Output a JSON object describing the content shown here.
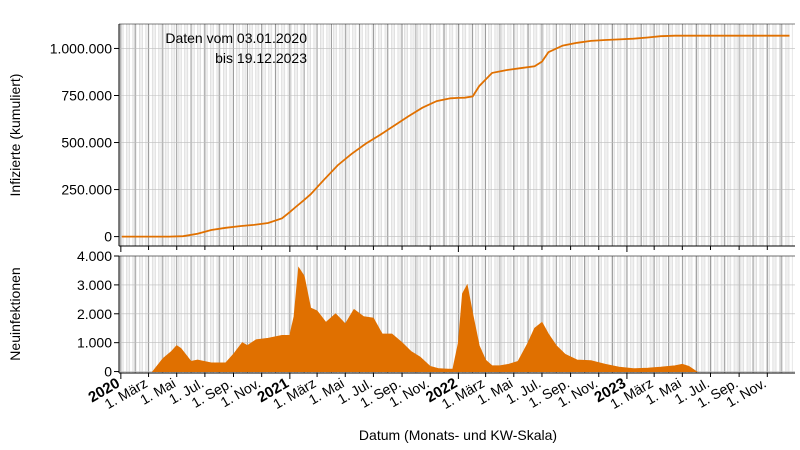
{
  "chart_data": [
    {
      "type": "line",
      "ylabel": "Infizierte (kumuliert)",
      "annotation": [
        "Daten vom 03.01.2020",
        "bis 19.12.2023"
      ],
      "ylim": [
        -50000,
        1130000
      ],
      "yticks": [
        0,
        250000,
        500000,
        750000,
        1000000
      ],
      "ytick_labels": [
        "0",
        "250.000",
        "500.000",
        "750.000",
        "1.000.000"
      ],
      "grid": true,
      "color": "#e07000",
      "x": [
        "2020-01-03",
        "2020-02-15",
        "2020-03-15",
        "2020-04-15",
        "2020-05-15",
        "2020-06-15",
        "2020-07-15",
        "2020-08-15",
        "2020-09-15",
        "2020-10-15",
        "2020-11-15",
        "2020-12-15",
        "2021-01-01",
        "2021-01-15",
        "2021-02-01",
        "2021-02-15",
        "2021-03-15",
        "2021-04-15",
        "2021-05-15",
        "2021-06-15",
        "2021-07-15",
        "2021-08-15",
        "2021-09-15",
        "2021-10-15",
        "2021-11-15",
        "2021-12-15",
        "2022-01-01",
        "2022-01-15",
        "2022-02-01",
        "2022-02-15",
        "2022-03-15",
        "2022-04-15",
        "2022-05-15",
        "2022-06-15",
        "2022-07-01",
        "2022-07-15",
        "2022-08-15",
        "2022-09-15",
        "2022-10-15",
        "2022-11-15",
        "2022-12-15",
        "2023-01-15",
        "2023-02-15",
        "2023-03-15",
        "2023-04-15",
        "2023-05-15",
        "2023-06-15",
        "2023-09-15",
        "2023-12-19"
      ],
      "values": [
        0,
        0,
        0,
        0,
        2000,
        15000,
        35000,
        47000,
        56000,
        62000,
        72000,
        97000,
        130000,
        160000,
        195000,
        225000,
        300000,
        380000,
        440000,
        495000,
        540000,
        590000,
        640000,
        685000,
        720000,
        735000,
        737000,
        738000,
        745000,
        800000,
        870000,
        885000,
        895000,
        905000,
        930000,
        980000,
        1015000,
        1030000,
        1040000,
        1045000,
        1048000,
        1052000,
        1058000,
        1065000,
        1068000,
        1068000,
        1068000,
        1068000,
        1068000
      ]
    },
    {
      "type": "area",
      "ylabel": "Neuinfektionen",
      "ylim": [
        -50,
        4000
      ],
      "yticks": [
        0,
        1000,
        2000,
        3000,
        4000
      ],
      "ytick_labels": [
        "0",
        "1.000",
        "2.000",
        "3.000",
        "4.000"
      ],
      "grid": true,
      "color": "#e07000",
      "x": [
        "2020-03-10",
        "2020-04-01",
        "2020-04-20",
        "2020-05-01",
        "2020-05-10",
        "2020-06-01",
        "2020-06-15",
        "2020-07-15",
        "2020-08-15",
        "2020-09-01",
        "2020-09-20",
        "2020-10-01",
        "2020-10-20",
        "2020-11-15",
        "2020-12-15",
        "2021-01-01",
        "2021-01-10",
        "2021-01-20",
        "2021-02-01",
        "2021-02-15",
        "2021-03-01",
        "2021-03-20",
        "2021-04-10",
        "2021-05-01",
        "2021-05-20",
        "2021-06-10",
        "2021-07-01",
        "2021-07-20",
        "2021-08-10",
        "2021-09-01",
        "2021-09-20",
        "2021-10-10",
        "2021-11-01",
        "2021-11-20",
        "2021-12-10",
        "2021-12-20",
        "2022-01-01",
        "2022-01-10",
        "2022-01-20",
        "2022-02-01",
        "2022-02-15",
        "2022-03-01",
        "2022-03-15",
        "2022-04-01",
        "2022-04-20",
        "2022-05-10",
        "2022-06-01",
        "2022-06-15",
        "2022-07-01",
        "2022-07-15",
        "2022-08-01",
        "2022-08-20",
        "2022-09-15",
        "2022-10-15",
        "2022-11-15",
        "2022-12-15",
        "2023-01-15",
        "2023-02-15",
        "2023-03-15",
        "2023-04-15",
        "2023-05-01",
        "2023-05-15",
        "2023-06-01"
      ],
      "values": [
        0,
        450,
        700,
        900,
        800,
        350,
        400,
        300,
        300,
        600,
        1000,
        900,
        1100,
        1150,
        1250,
        1250,
        1900,
        3600,
        3300,
        2200,
        2100,
        1700,
        2000,
        1650,
        2150,
        1900,
        1850,
        1300,
        1300,
        1000,
        700,
        500,
        180,
        100,
        80,
        80,
        1000,
        2700,
        3000,
        2000,
        900,
        400,
        200,
        200,
        250,
        350,
        1000,
        1500,
        1700,
        1300,
        900,
        600,
        400,
        380,
        250,
        150,
        100,
        120,
        150,
        200,
        250,
        180,
        0
      ]
    }
  ],
  "xaxis": {
    "label": "Datum (Monats- und KW-Skala)",
    "ticks": [
      {
        "date": "2020-01-01",
        "text": "2020",
        "year": true
      },
      {
        "date": "2020-03-01",
        "text": "1. März",
        "year": false
      },
      {
        "date": "2020-05-01",
        "text": "1. Mai",
        "year": false
      },
      {
        "date": "2020-07-01",
        "text": "1. Jul.",
        "year": false
      },
      {
        "date": "2020-09-01",
        "text": "1. Sep.",
        "year": false
      },
      {
        "date": "2020-11-01",
        "text": "1. Nov.",
        "year": false
      },
      {
        "date": "2021-01-01",
        "text": "2021",
        "year": true
      },
      {
        "date": "2021-03-01",
        "text": "1. März",
        "year": false
      },
      {
        "date": "2021-05-01",
        "text": "1. Mai",
        "year": false
      },
      {
        "date": "2021-07-01",
        "text": "1. Jul.",
        "year": false
      },
      {
        "date": "2021-09-01",
        "text": "1. Sep.",
        "year": false
      },
      {
        "date": "2021-11-01",
        "text": "1. Nov.",
        "year": false
      },
      {
        "date": "2022-01-01",
        "text": "2022",
        "year": true
      },
      {
        "date": "2022-03-01",
        "text": "1. März",
        "year": false
      },
      {
        "date": "2022-05-01",
        "text": "1. Mai",
        "year": false
      },
      {
        "date": "2022-07-01",
        "text": "1. Jul.",
        "year": false
      },
      {
        "date": "2022-09-01",
        "text": "1. Sep.",
        "year": false
      },
      {
        "date": "2022-11-01",
        "text": "1. Nov.",
        "year": false
      },
      {
        "date": "2023-01-01",
        "text": "2023",
        "year": true
      },
      {
        "date": "2023-03-01",
        "text": "1. März",
        "year": false
      },
      {
        "date": "2023-05-01",
        "text": "1. Mai",
        "year": false
      },
      {
        "date": "2023-07-01",
        "text": "1. Jul.",
        "year": false
      },
      {
        "date": "2023-09-01",
        "text": "1. Sep.",
        "year": false
      },
      {
        "date": "2023-11-01",
        "text": "1. Nov.",
        "year": false
      }
    ],
    "range": [
      "2019-12-28",
      "2023-12-31"
    ]
  }
}
